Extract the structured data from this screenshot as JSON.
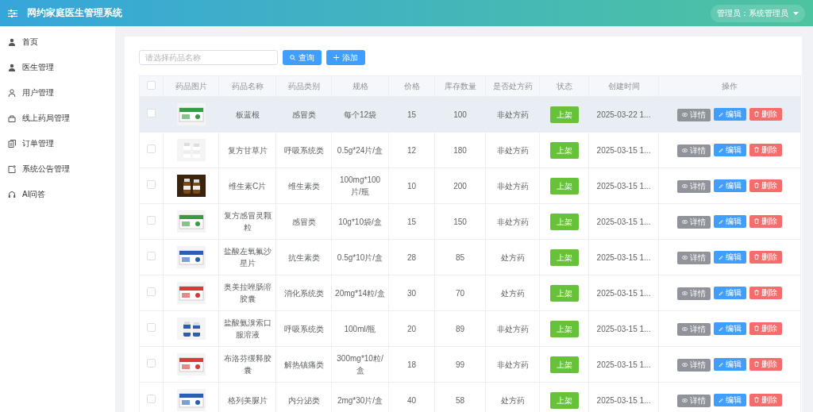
{
  "header": {
    "title": "网约家庭医生管理系统",
    "user": "管理员：系统管理员"
  },
  "sidebar": {
    "items": [
      {
        "label": "首页",
        "selected": false
      },
      {
        "label": "医生管理",
        "selected": false
      },
      {
        "label": "用户管理",
        "selected": false
      },
      {
        "label": "线上药局管理",
        "selected": false
      },
      {
        "label": "订单管理",
        "selected": false
      },
      {
        "label": "系统公告管理",
        "selected": false
      },
      {
        "label": "AI问答",
        "selected": false
      }
    ]
  },
  "toolbar": {
    "search": {
      "placeholder": "请选择药品名称"
    },
    "query_button": "查询",
    "add_button": "添加"
  },
  "table": {
    "all_checked": false,
    "columns": [
      "药品图片",
      "药品名称",
      "药品类别",
      "规格",
      "价格",
      "库存数量",
      "是否处方药",
      "状态",
      "创建时间",
      "操作"
    ],
    "rows": [
      {
        "checked": false,
        "highlighted": true,
        "name": "板蓝根",
        "category": "感冒类",
        "spec": "每个12袋",
        "price": "15",
        "stock": "100",
        "rx": "非处方药",
        "status": "上架",
        "created": "2025-03-22 1...",
        "actions": [
          "详情",
          "编辑",
          "删除"
        ]
      },
      {
        "checked": false,
        "highlighted": false,
        "name": "复方甘草片",
        "category": "呼吸系统类",
        "spec": "0.5g*24片/盒",
        "price": "12",
        "stock": "180",
        "rx": "非处方药",
        "status": "上架",
        "created": "2025-03-15 1...",
        "actions": [
          "详情",
          "编辑",
          "删除"
        ]
      },
      {
        "checked": false,
        "highlighted": false,
        "name": "维生素C片",
        "category": "维生素类",
        "spec": "100mg*100片/瓶",
        "price": "10",
        "stock": "200",
        "rx": "非处方药",
        "status": "上架",
        "created": "2025-03-15 1...",
        "actions": [
          "详情",
          "编辑",
          "删除"
        ]
      },
      {
        "checked": false,
        "highlighted": false,
        "name": "复方感冒灵颗粒",
        "category": "感冒类",
        "spec": "10g*10袋/盒",
        "price": "15",
        "stock": "150",
        "rx": "非处方药",
        "status": "上架",
        "created": "2025-03-15 1...",
        "actions": [
          "详情",
          "编辑",
          "删除"
        ]
      },
      {
        "checked": false,
        "highlighted": false,
        "name": "盐酸左氧氟沙星片",
        "category": "抗生素类",
        "spec": "0.5g*10片/盒",
        "price": "28",
        "stock": "85",
        "rx": "处方药",
        "status": "上架",
        "created": "2025-03-15 1...",
        "actions": [
          "详情",
          "编辑",
          "删除"
        ]
      },
      {
        "checked": false,
        "highlighted": false,
        "name": "奥美拉唑肠溶胶囊",
        "category": "消化系统类",
        "spec": "20mg*14粒/盒",
        "price": "30",
        "stock": "70",
        "rx": "处方药",
        "status": "上架",
        "created": "2025-03-15 1...",
        "actions": [
          "详情",
          "编辑",
          "删除"
        ]
      },
      {
        "checked": false,
        "highlighted": false,
        "name": "盐酸氨溴索口服溶液",
        "category": "呼吸系统类",
        "spec": "100ml/瓶",
        "price": "20",
        "stock": "89",
        "rx": "非处方药",
        "status": "上架",
        "created": "2025-03-15 1...",
        "actions": [
          "详情",
          "编辑",
          "删除"
        ]
      },
      {
        "checked": false,
        "highlighted": false,
        "name": "布洛芬缓释胶囊",
        "category": "解热镇痛类",
        "spec": "300mg*10粒/盒",
        "price": "18",
        "stock": "99",
        "rx": "非处方药",
        "status": "上架",
        "created": "2025-03-15 1...",
        "actions": [
          "详情",
          "编辑",
          "删除"
        ]
      },
      {
        "checked": false,
        "highlighted": false,
        "name": "格列美脲片",
        "category": "内分泌类",
        "spec": "2mg*30片/盒",
        "price": "40",
        "stock": "58",
        "rx": "处方药",
        "status": "上架",
        "created": "2025-03-15 1...",
        "actions": [
          "详情",
          "编辑",
          "删除"
        ]
      }
    ]
  }
}
